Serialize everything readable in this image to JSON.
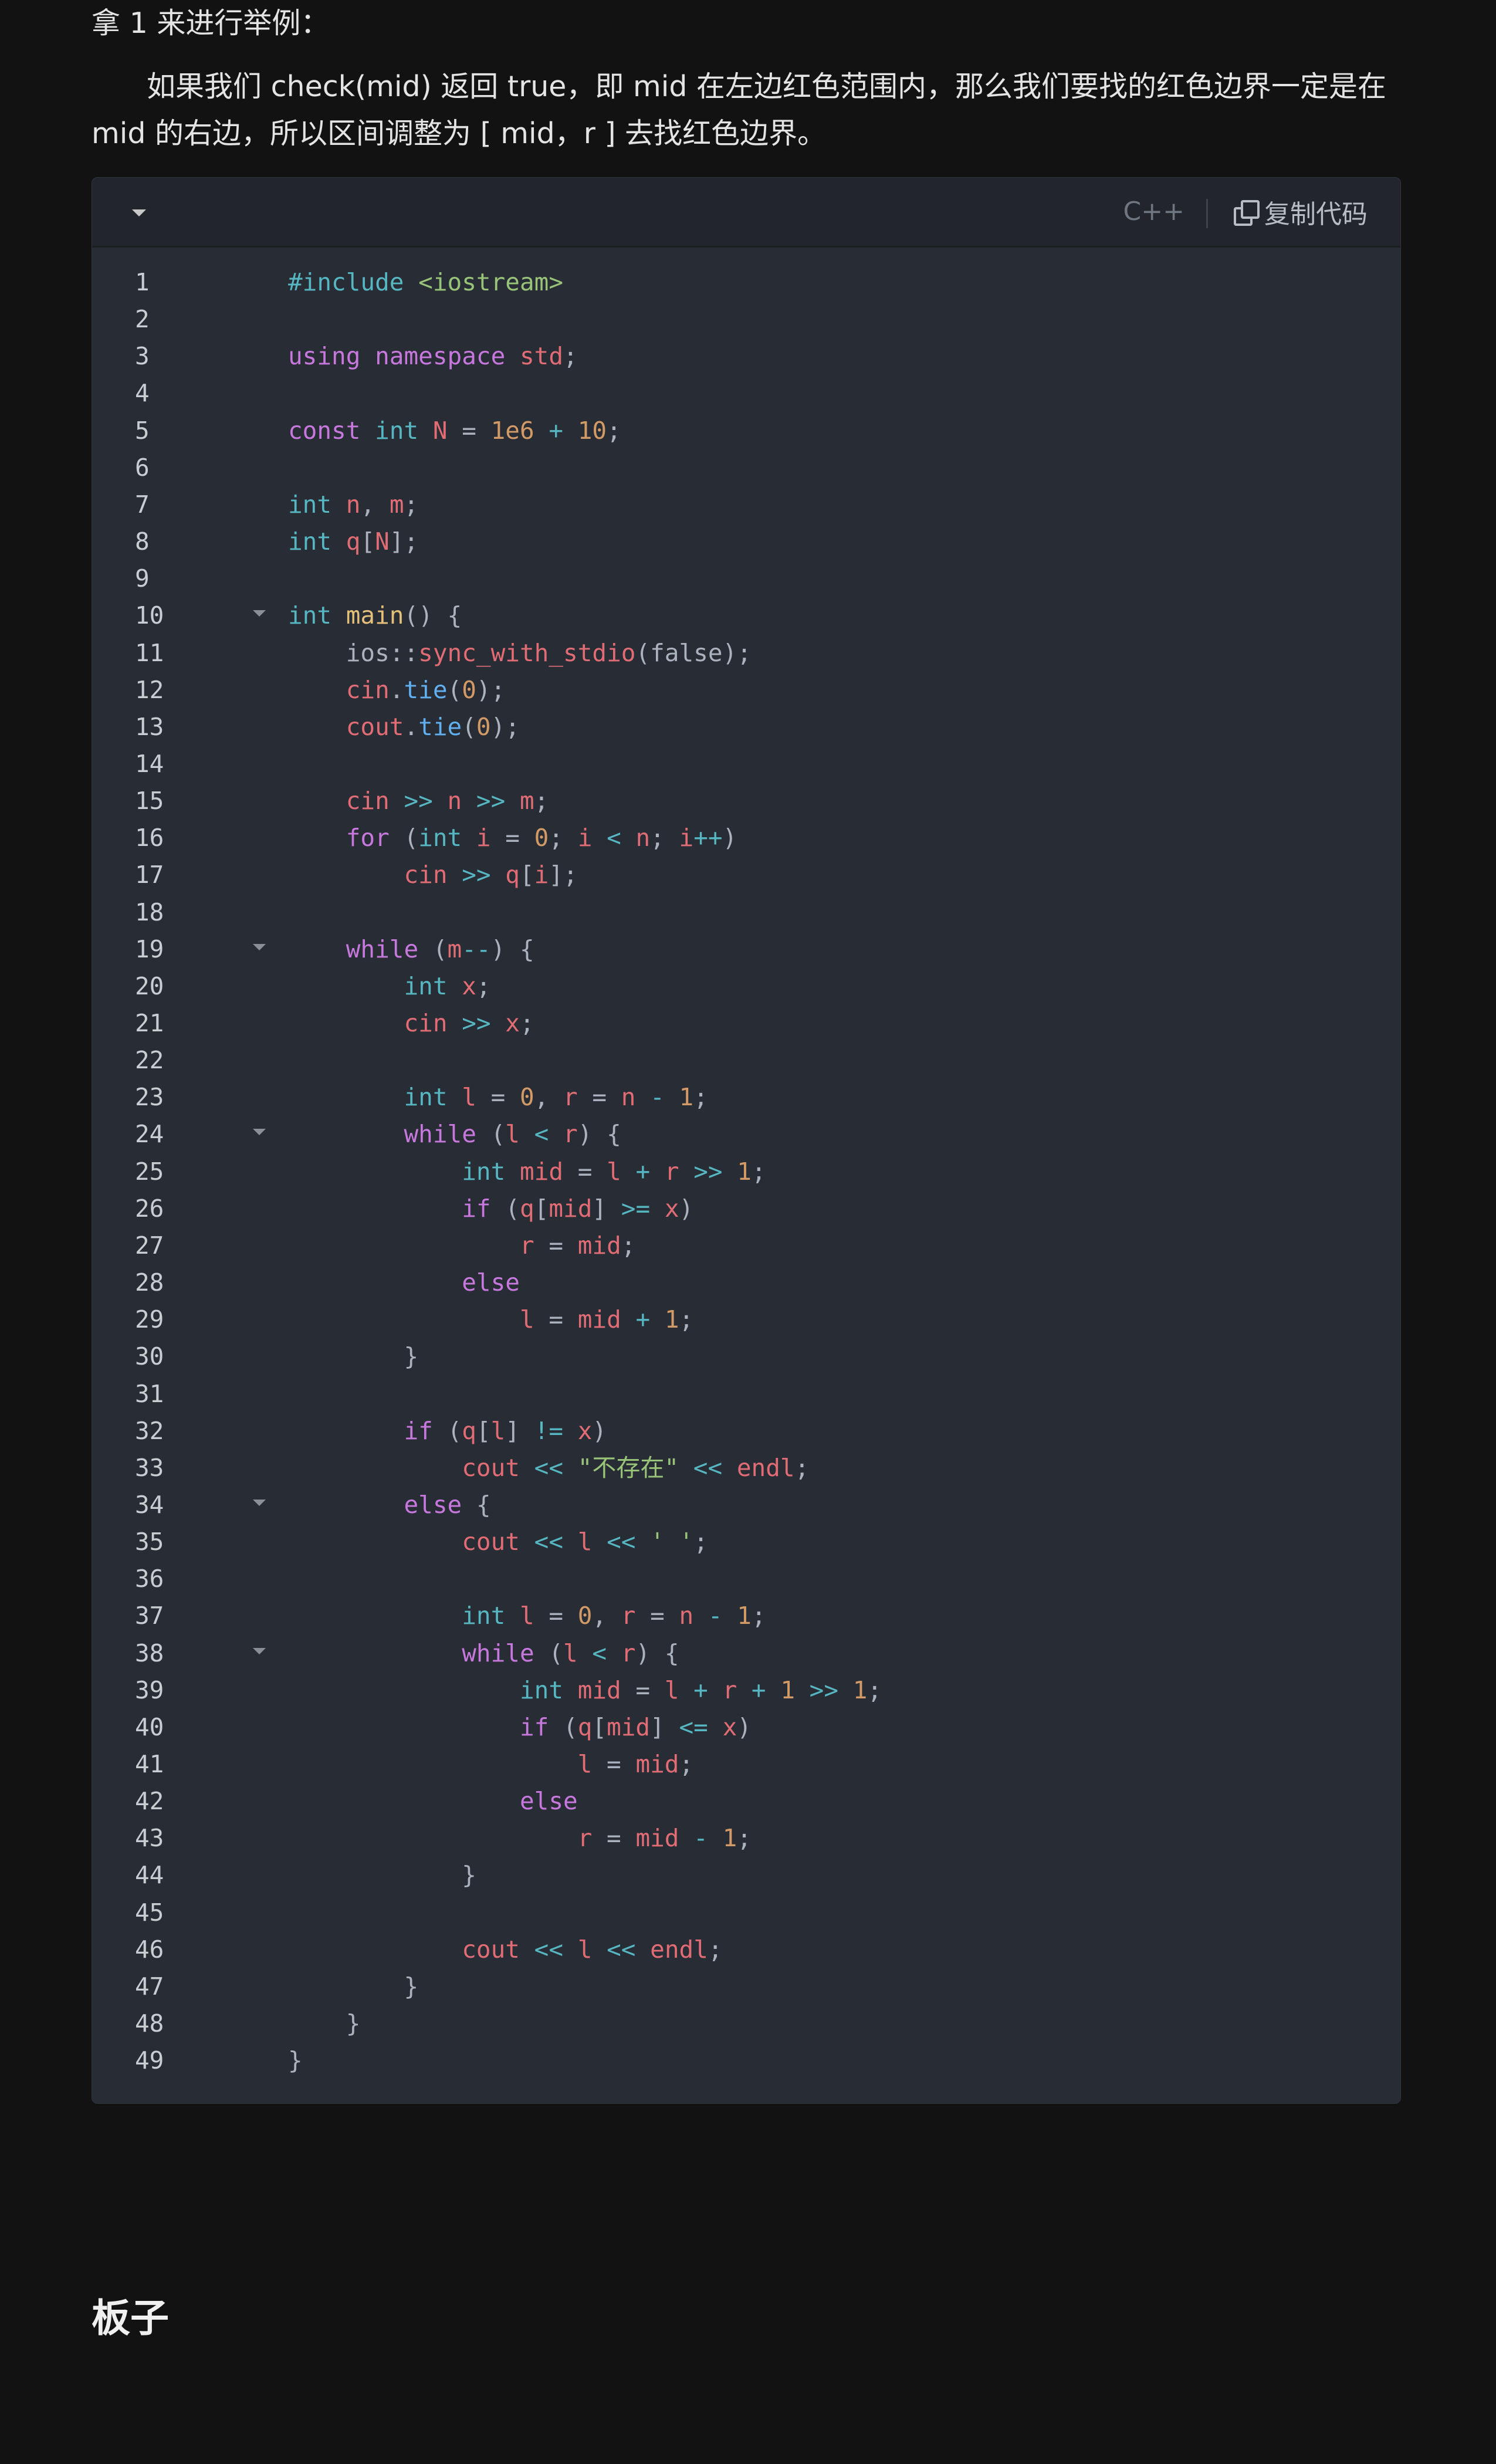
{
  "article": {
    "para1": "拿 1 来进行举例：",
    "para2": "如果我们 check(mid) 返回 true，即 mid 在左边红色范围内，那么我们要找的红色边界一定是在 mid 的右边，所以区间调整为 [ mid，r ] 去找红色边界。",
    "heading": "板子"
  },
  "code_block": {
    "language": "C++",
    "copy_label": "复制代码",
    "fold_lines": [
      10,
      19,
      24,
      34,
      38
    ],
    "lines": [
      [
        [
          "pp",
          "#include "
        ],
        [
          "str",
          "<iostream>"
        ]
      ],
      [],
      [
        [
          "kw",
          "using namespace "
        ],
        [
          "var",
          "std"
        ],
        [
          "p",
          ";"
        ]
      ],
      [],
      [
        [
          "kw",
          "const "
        ],
        [
          "ty",
          "int "
        ],
        [
          "var",
          "N"
        ],
        [
          "p",
          " = "
        ],
        [
          "num",
          "1e6"
        ],
        [
          "op",
          " + "
        ],
        [
          "num",
          "10"
        ],
        [
          "p",
          ";"
        ]
      ],
      [],
      [
        [
          "ty",
          "int "
        ],
        [
          "var",
          "n"
        ],
        [
          "p",
          ", "
        ],
        [
          "var",
          "m"
        ],
        [
          "p",
          ";"
        ]
      ],
      [
        [
          "ty",
          "int "
        ],
        [
          "var",
          "q"
        ],
        [
          "p",
          "["
        ],
        [
          "var",
          "N"
        ],
        [
          "p",
          "];"
        ]
      ],
      [],
      [
        [
          "ty",
          "int "
        ],
        [
          "fn",
          "main"
        ],
        [
          "p",
          "() {"
        ]
      ],
      [
        [
          "p",
          "    ios::"
        ],
        [
          "var",
          "sync_with_stdio"
        ],
        [
          "p",
          "(false);"
        ]
      ],
      [
        [
          "var",
          "    cin"
        ],
        [
          "p",
          "."
        ],
        [
          "meth",
          "tie"
        ],
        [
          "p",
          "("
        ],
        [
          "num",
          "0"
        ],
        [
          "p",
          ");"
        ]
      ],
      [
        [
          "var",
          "    cout"
        ],
        [
          "p",
          "."
        ],
        [
          "meth",
          "tie"
        ],
        [
          "p",
          "("
        ],
        [
          "num",
          "0"
        ],
        [
          "p",
          ");"
        ]
      ],
      [],
      [
        [
          "var",
          "    cin "
        ],
        [
          "op",
          ">> "
        ],
        [
          "var",
          "n "
        ],
        [
          "op",
          ">> "
        ],
        [
          "var",
          "m"
        ],
        [
          "p",
          ";"
        ]
      ],
      [
        [
          "kw",
          "    for "
        ],
        [
          "p",
          "("
        ],
        [
          "ty",
          "int "
        ],
        [
          "var",
          "i"
        ],
        [
          "p",
          " = "
        ],
        [
          "num",
          "0"
        ],
        [
          "p",
          "; "
        ],
        [
          "var",
          "i"
        ],
        [
          "op",
          " < "
        ],
        [
          "var",
          "n"
        ],
        [
          "p",
          "; "
        ],
        [
          "var",
          "i"
        ],
        [
          "op",
          "++"
        ],
        [
          "p",
          ")"
        ]
      ],
      [
        [
          "var",
          "        cin "
        ],
        [
          "op",
          ">> "
        ],
        [
          "var",
          "q"
        ],
        [
          "p",
          "["
        ],
        [
          "var",
          "i"
        ],
        [
          "p",
          "];"
        ]
      ],
      [],
      [
        [
          "kw",
          "    while "
        ],
        [
          "p",
          "("
        ],
        [
          "var",
          "m"
        ],
        [
          "op",
          "--"
        ],
        [
          "p",
          ") {"
        ]
      ],
      [
        [
          "ty",
          "        int "
        ],
        [
          "var",
          "x"
        ],
        [
          "p",
          ";"
        ]
      ],
      [
        [
          "var",
          "        cin "
        ],
        [
          "op",
          ">> "
        ],
        [
          "var",
          "x"
        ],
        [
          "p",
          ";"
        ]
      ],
      [],
      [
        [
          "ty",
          "        int "
        ],
        [
          "var",
          "l"
        ],
        [
          "p",
          " = "
        ],
        [
          "num",
          "0"
        ],
        [
          "p",
          ", "
        ],
        [
          "var",
          "r"
        ],
        [
          "p",
          " = "
        ],
        [
          "var",
          "n"
        ],
        [
          "op",
          " - "
        ],
        [
          "num",
          "1"
        ],
        [
          "p",
          ";"
        ]
      ],
      [
        [
          "kw",
          "        while "
        ],
        [
          "p",
          "("
        ],
        [
          "var",
          "l"
        ],
        [
          "op",
          " < "
        ],
        [
          "var",
          "r"
        ],
        [
          "p",
          ") {"
        ]
      ],
      [
        [
          "ty",
          "            int "
        ],
        [
          "var",
          "mid"
        ],
        [
          "p",
          " = "
        ],
        [
          "var",
          "l"
        ],
        [
          "op",
          " + "
        ],
        [
          "var",
          "r"
        ],
        [
          "op",
          " >> "
        ],
        [
          "num",
          "1"
        ],
        [
          "p",
          ";"
        ]
      ],
      [
        [
          "kw",
          "            if "
        ],
        [
          "p",
          "("
        ],
        [
          "var",
          "q"
        ],
        [
          "p",
          "["
        ],
        [
          "var",
          "mid"
        ],
        [
          "p",
          "] "
        ],
        [
          "op",
          ">= "
        ],
        [
          "var",
          "x"
        ],
        [
          "p",
          ")"
        ]
      ],
      [
        [
          "var",
          "                r"
        ],
        [
          "p",
          " = "
        ],
        [
          "var",
          "mid"
        ],
        [
          "p",
          ";"
        ]
      ],
      [
        [
          "kw",
          "            else"
        ]
      ],
      [
        [
          "var",
          "                l"
        ],
        [
          "p",
          " = "
        ],
        [
          "var",
          "mid"
        ],
        [
          "op",
          " + "
        ],
        [
          "num",
          "1"
        ],
        [
          "p",
          ";"
        ]
      ],
      [
        [
          "p",
          "        }"
        ]
      ],
      [],
      [
        [
          "kw",
          "        if "
        ],
        [
          "p",
          "("
        ],
        [
          "var",
          "q"
        ],
        [
          "p",
          "["
        ],
        [
          "var",
          "l"
        ],
        [
          "p",
          "] "
        ],
        [
          "op",
          "!= "
        ],
        [
          "var",
          "x"
        ],
        [
          "p",
          ")"
        ]
      ],
      [
        [
          "var",
          "            cout "
        ],
        [
          "op",
          "<< "
        ],
        [
          "str",
          "\"不存在\" "
        ],
        [
          "op",
          "<< "
        ],
        [
          "var",
          "endl"
        ],
        [
          "p",
          ";"
        ]
      ],
      [
        [
          "kw",
          "        else "
        ],
        [
          "p",
          "{"
        ]
      ],
      [
        [
          "var",
          "            cout "
        ],
        [
          "op",
          "<< "
        ],
        [
          "var",
          "l "
        ],
        [
          "op",
          "<< "
        ],
        [
          "str",
          "' '"
        ],
        [
          "p",
          ";"
        ]
      ],
      [],
      [
        [
          "ty",
          "            int "
        ],
        [
          "var",
          "l"
        ],
        [
          "p",
          " = "
        ],
        [
          "num",
          "0"
        ],
        [
          "p",
          ", "
        ],
        [
          "var",
          "r"
        ],
        [
          "p",
          " = "
        ],
        [
          "var",
          "n"
        ],
        [
          "op",
          " - "
        ],
        [
          "num",
          "1"
        ],
        [
          "p",
          ";"
        ]
      ],
      [
        [
          "kw",
          "            while "
        ],
        [
          "p",
          "("
        ],
        [
          "var",
          "l"
        ],
        [
          "op",
          " < "
        ],
        [
          "var",
          "r"
        ],
        [
          "p",
          ") {"
        ]
      ],
      [
        [
          "ty",
          "                int "
        ],
        [
          "var",
          "mid"
        ],
        [
          "p",
          " = "
        ],
        [
          "var",
          "l"
        ],
        [
          "op",
          " + "
        ],
        [
          "var",
          "r"
        ],
        [
          "op",
          " + "
        ],
        [
          "num",
          "1"
        ],
        [
          "op",
          " >> "
        ],
        [
          "num",
          "1"
        ],
        [
          "p",
          ";"
        ]
      ],
      [
        [
          "kw",
          "                if "
        ],
        [
          "p",
          "("
        ],
        [
          "var",
          "q"
        ],
        [
          "p",
          "["
        ],
        [
          "var",
          "mid"
        ],
        [
          "p",
          "] "
        ],
        [
          "op",
          "<= "
        ],
        [
          "var",
          "x"
        ],
        [
          "p",
          ")"
        ]
      ],
      [
        [
          "var",
          "                    l"
        ],
        [
          "p",
          " = "
        ],
        [
          "var",
          "mid"
        ],
        [
          "p",
          ";"
        ]
      ],
      [
        [
          "kw",
          "                else"
        ]
      ],
      [
        [
          "var",
          "                    r"
        ],
        [
          "p",
          " = "
        ],
        [
          "var",
          "mid"
        ],
        [
          "op",
          " - "
        ],
        [
          "num",
          "1"
        ],
        [
          "p",
          ";"
        ]
      ],
      [
        [
          "p",
          "            }"
        ]
      ],
      [],
      [
        [
          "var",
          "            cout "
        ],
        [
          "op",
          "<< "
        ],
        [
          "var",
          "l "
        ],
        [
          "op",
          "<< "
        ],
        [
          "var",
          "endl"
        ],
        [
          "p",
          ";"
        ]
      ],
      [
        [
          "p",
          "        }"
        ]
      ],
      [
        [
          "p",
          "    }"
        ]
      ],
      [
        [
          "p",
          "}"
        ]
      ]
    ]
  }
}
